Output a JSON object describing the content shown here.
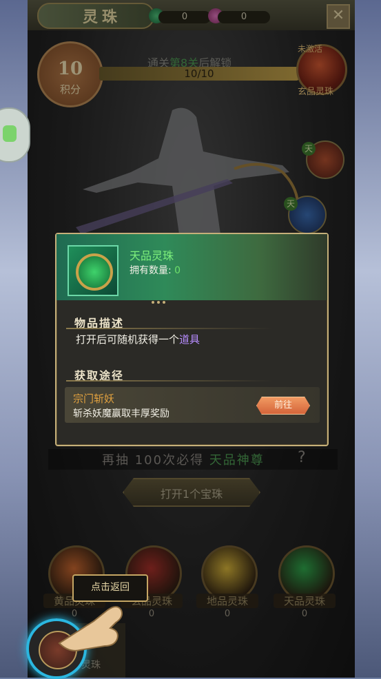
{
  "title": "灵珠",
  "currency": [
    {
      "icon": "green-jade-icon",
      "value": "0"
    },
    {
      "icon": "pink-flower-icon",
      "value": "0"
    }
  ],
  "close_label": "✕",
  "badge": {
    "value": "10",
    "label": "积分"
  },
  "unlock": {
    "prefix": "通关",
    "stage": "第8关",
    "suffix": "后解锁",
    "progress_text": "10/10",
    "progress_fraction": 1.0
  },
  "reward_orb": {
    "status": "未激活",
    "name": "玄品灵珠"
  },
  "tian_mark": "天",
  "popup": {
    "item_name": "天品灵珠",
    "own_label": "拥有数量:",
    "own_value": "0",
    "desc_title": "物品描述",
    "desc_text": "打开后可随机获得一个",
    "desc_highlight": "道具",
    "source_title": "获取途径",
    "route_title": "宗门斩妖",
    "route_desc": "斩杀妖魔赢取丰厚奖励",
    "go_label": "前往"
  },
  "draw": {
    "prefix": "再抽 100次必得",
    "highlight": "天品神尊",
    "help": "?"
  },
  "open_button": "打开1个宝珠",
  "orbs": [
    {
      "name": "黄品灵珠",
      "count": "0",
      "color": "#c9672f"
    },
    {
      "name": "玄品灵珠",
      "count": "0",
      "color": "#a8302a"
    },
    {
      "name": "地品灵珠",
      "count": "0",
      "color": "#d8b53a"
    },
    {
      "name": "天品灵珠",
      "count": "0",
      "color": "#2ea84c"
    }
  ],
  "bottom_tab": "灵珠",
  "tutorial": {
    "tip": "点击返回"
  }
}
